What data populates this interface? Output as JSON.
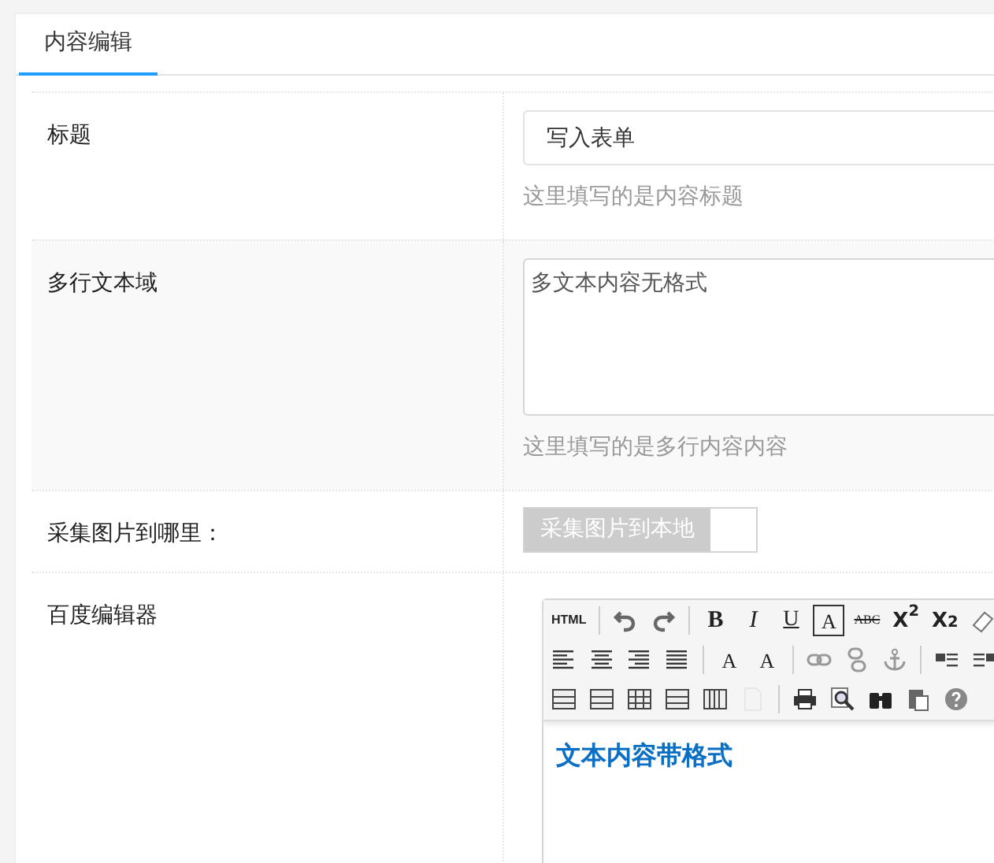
{
  "tabs": [
    {
      "label": "内容编辑",
      "selected": true
    }
  ],
  "fields": [
    {
      "kind": "text",
      "label": "标题",
      "value": "写入表单",
      "hint": "这里填写的是内容标题"
    },
    {
      "kind": "textarea",
      "label": "多行文本域",
      "value": "多文本内容无格式",
      "hint": "这里填写的是多行内容内容"
    },
    {
      "kind": "toggle",
      "label": "采集图片到哪里：",
      "toggle_label": "采集图片到本地",
      "on": false
    },
    {
      "kind": "editor",
      "label": "百度编辑器",
      "toolbar": [
        [
          [
            {
              "text": "HTML",
              "disabled": false
            }
          ],
          [
            {
              "disabled": false
            },
            {
              "disabled": false
            }
          ],
          [
            {
              "text": "B",
              "disabled": false
            },
            {
              "text": "I",
              "disabled": false
            },
            {
              "text": "U",
              "disabled": false
            },
            {
              "text": "A",
              "disabled": false
            },
            {
              "text": "ABC",
              "disabled": false
            },
            {
              "text": "X$^{2}$",
              "disabled": false
            },
            {
              "text": "X$_{2}$",
              "disabled": false
            },
            {
              "disabled": false
            }
          ]
        ],
        [
          [
            {
              "disabled": false
            },
            {
              "disabled": false
            },
            {
              "disabled": false
            },
            {
              "disabled": false
            }
          ],
          [
            {
              "text": "A",
              "disabled": false
            },
            {
              "text": "A",
              "disabled": false
            }
          ],
          [
            {
              "disabled": false
            },
            {
              "disabled": false
            },
            {
              "disabled": false
            }
          ],
          [
            {
              "disabled": false
            },
            {
              "disabled": false
            }
          ]
        ],
        [
          [
            {
              "disabled": false
            },
            {
              "disabled": false
            },
            {
              "disabled": false
            },
            {
              "disabled": false
            },
            {
              "disabled": false
            },
            {
              "disabled": true
            }
          ],
          [
            {
              "disabled": false
            },
            {
              "disabled": false
            },
            {
              "disabled": false
            },
            {
              "disabled": false
            },
            {
              "disabled": false
            }
          ]
        ]
      ],
      "content": "文本内容带格式"
    }
  ]
}
